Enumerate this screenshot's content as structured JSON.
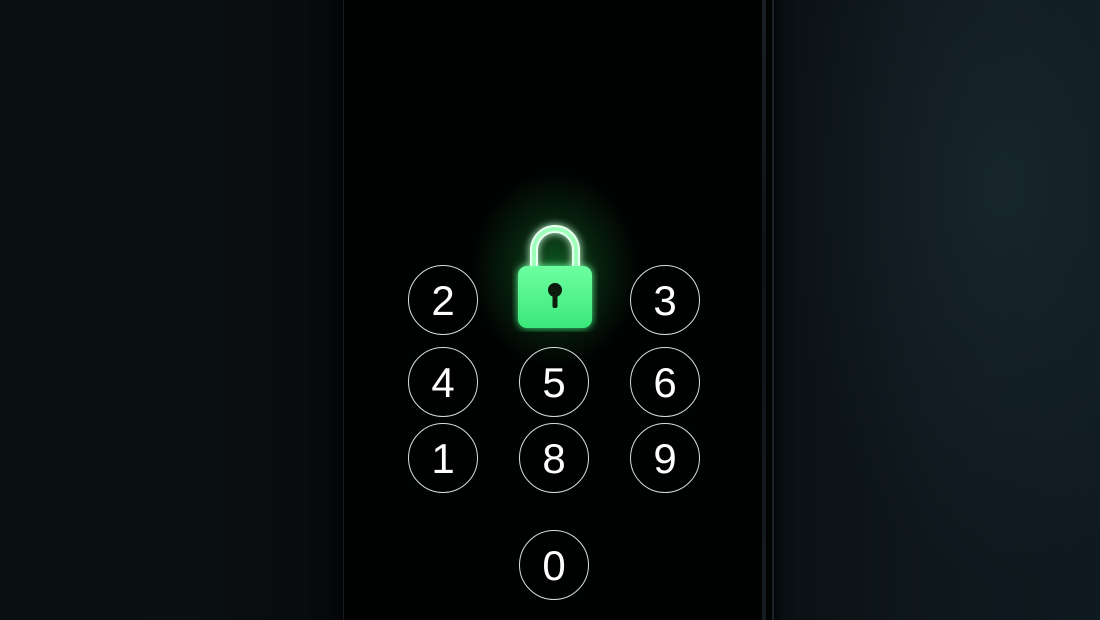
{
  "keypad": {
    "keys": [
      {
        "id": "2",
        "label": "2"
      },
      {
        "id": "3",
        "label": "3"
      },
      {
        "id": "4",
        "label": "4"
      },
      {
        "id": "5",
        "label": "5"
      },
      {
        "id": "6",
        "label": "6"
      },
      {
        "id": "1",
        "label": "1"
      },
      {
        "id": "8",
        "label": "8"
      },
      {
        "id": "9",
        "label": "9"
      },
      {
        "id": "0",
        "label": "0"
      }
    ]
  },
  "lock": {
    "icon": "padlock-icon",
    "state": "locked",
    "color": "#3dff7a",
    "glow_color": "#28ff5a"
  },
  "colors": {
    "key_border": "#d9dee0",
    "key_text": "#ffffff",
    "screen": "#010202"
  }
}
